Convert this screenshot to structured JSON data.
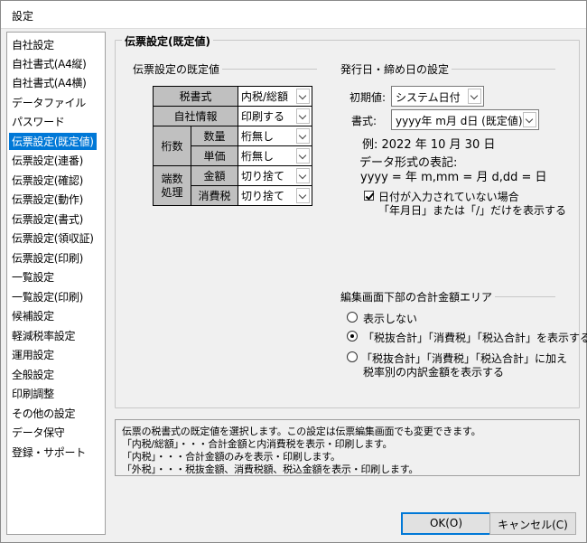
{
  "window": {
    "title": "設定"
  },
  "sidebar": {
    "items": [
      "自社設定",
      "自社書式(A4縦)",
      "自社書式(A4横)",
      "データファイル",
      "パスワード",
      "伝票設定(既定値)",
      "伝票設定(連番)",
      "伝票設定(確認)",
      "伝票設定(動作)",
      "伝票設定(書式)",
      "伝票設定(領収証)",
      "伝票設定(印刷)",
      "一覧設定",
      "一覧設定(印刷)",
      "候補設定",
      "軽減税率設定",
      "運用設定",
      "全般設定",
      "印刷調整",
      "その他の設定",
      "データ保守",
      "登録・サポート"
    ],
    "selected_index": 5
  },
  "main": {
    "group_title": "伝票設定(既定値)",
    "defaults": {
      "label": "伝票設定の既定値",
      "tax_format": {
        "label": "税書式",
        "value": "内税/総額"
      },
      "company_info": {
        "label": "自社情報",
        "value": "印刷する"
      },
      "digits": {
        "label": "桁数",
        "quantity_label": "数量",
        "quantity_value": "桁無し",
        "price_label": "単価",
        "price_value": "桁無し"
      },
      "rounding": {
        "label1": "端数",
        "label2": "処理",
        "amount_label": "金額",
        "amount_value": "切り捨て",
        "tax_label": "消費税",
        "tax_value": "切り捨て"
      }
    },
    "dates": {
      "label": "発行日・締め日の設定",
      "initial_label": "初期値:",
      "initial_value": "システム日付",
      "format_label": "書式:",
      "format_value": "yyyy年 m月 d日 (既定値)",
      "example": "例: 2022 年 10 月 30 日",
      "notation_title": "データ形式の表記:",
      "notation_body": "yyyy = 年 m,mm = 月 d,dd = 日",
      "show_blank_checked": true,
      "show_blank_line1": "日付が入力されていない場合",
      "show_blank_line2": "「年月日」または「/」だけを表示する"
    },
    "totals": {
      "label": "編集画面下部の合計金額エリア",
      "options": [
        {
          "line1": "表示しない",
          "checked": false
        },
        {
          "line1": "「税抜合計」「消費税」「税込合計」を表示する",
          "checked": true
        },
        {
          "line1": "「税抜合計」「消費税」「税込合計」に加え",
          "line2": "税率別の内訳金額を表示する",
          "checked": false
        }
      ]
    }
  },
  "description": {
    "lines": [
      "伝票の税書式の既定値を選択します。この設定は伝票編集画面でも変更できます。",
      "「内税/総額」・・・合計金額と内消費税を表示・印刷します。",
      "「内税」・・・合計金額のみを表示・印刷します。",
      "「外税」・・・税抜金額、消費税額、税込金額を表示・印刷します。"
    ]
  },
  "buttons": {
    "ok": "OK(O)",
    "cancel": "キャンセル(C)"
  }
}
